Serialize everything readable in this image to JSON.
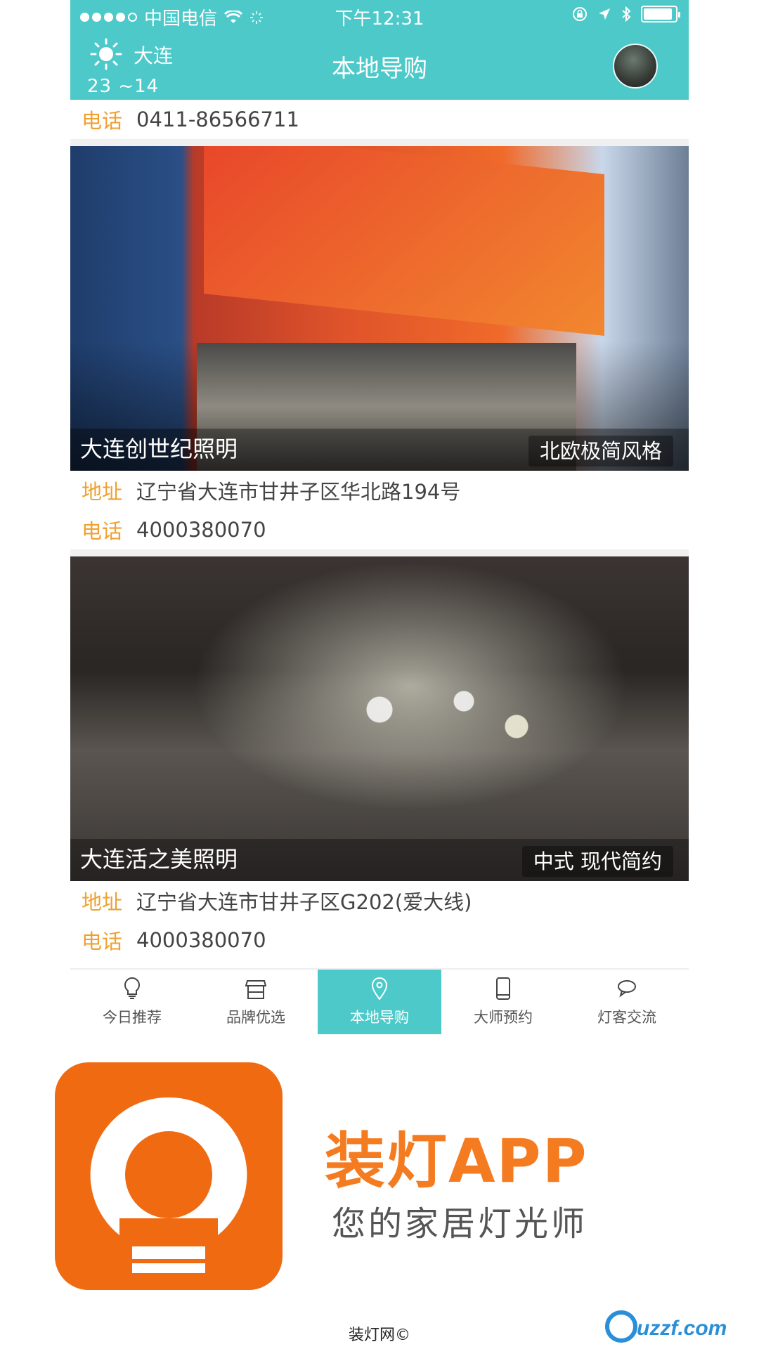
{
  "status_bar": {
    "carrier": "中国电信",
    "time": "下午12:31",
    "battery_level": 0.9
  },
  "header": {
    "city": "大连",
    "temperature": "23 ~14",
    "title": "本地导购"
  },
  "top_phone": {
    "label": "电话",
    "value": "0411-86566711"
  },
  "stores": [
    {
      "name": "大连创世纪照明",
      "style": "北欧极简风格",
      "address_label": "地址",
      "address": "辽宁省大连市甘井子区华北路194号",
      "phone_label": "电话",
      "phone": "4000380070"
    },
    {
      "name": "大连活之美照明",
      "style": "中式 现代简约",
      "address_label": "地址",
      "address": "辽宁省大连市甘井子区G202(爱大线)",
      "phone_label": "电话",
      "phone": "4000380070"
    }
  ],
  "tabs": [
    {
      "label": "今日推荐",
      "icon": "lightbulb-icon",
      "active": false
    },
    {
      "label": "品牌优选",
      "icon": "store-icon",
      "active": false
    },
    {
      "label": "本地导购",
      "icon": "location-pin-icon",
      "active": true
    },
    {
      "label": "大师预约",
      "icon": "phone-icon",
      "active": false
    },
    {
      "label": "灯客交流",
      "icon": "chat-bubble-icon",
      "active": false
    }
  ],
  "promo": {
    "app_name": "装灯APP",
    "tagline": "您的家居灯光师",
    "copyright": "装灯网©",
    "site_badge": "uzzf.com"
  },
  "colors": {
    "accent": "#4dc9c9",
    "label": "#f0a030",
    "brand": "#f06a12"
  }
}
